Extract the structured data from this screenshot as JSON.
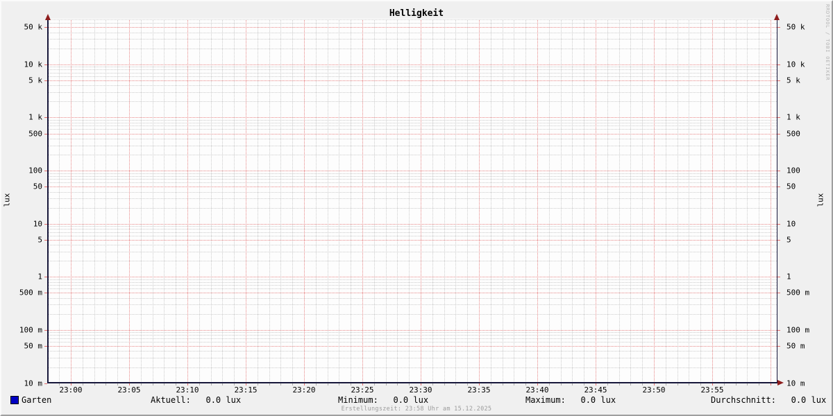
{
  "title": "Helligkeit",
  "watermark": "RRDTOOL / TOBI OETIKER",
  "footer": "Erstellungszeit: 23:58 Uhr am 15.12.2025",
  "axis": {
    "left_label": "lux",
    "right_label": "lux",
    "y_ticks": [
      {
        "label": "50 k",
        "value": 50000
      },
      {
        "label": "10 k",
        "value": 10000
      },
      {
        "label": "5 k",
        "value": 5000
      },
      {
        "label": "1 k",
        "value": 1000
      },
      {
        "label": "500",
        "value": 500
      },
      {
        "label": "100",
        "value": 100
      },
      {
        "label": "50",
        "value": 50
      },
      {
        "label": "10",
        "value": 10
      },
      {
        "label": "5",
        "value": 5
      },
      {
        "label": "1",
        "value": 1
      },
      {
        "label": "500 m",
        "value": 0.5
      },
      {
        "label": "100 m",
        "value": 0.1
      },
      {
        "label": "50 m",
        "value": 0.05
      },
      {
        "label": "10 m",
        "value": 0.01
      }
    ],
    "x_ticks": [
      {
        "label": "23:00",
        "minute": 0
      },
      {
        "label": "23:05",
        "minute": 5
      },
      {
        "label": "23:10",
        "minute": 10
      },
      {
        "label": "23:15",
        "minute": 15
      },
      {
        "label": "23:20",
        "minute": 20
      },
      {
        "label": "23:25",
        "minute": 25
      },
      {
        "label": "23:30",
        "minute": 30
      },
      {
        "label": "23:35",
        "minute": 35
      },
      {
        "label": "23:40",
        "minute": 40
      },
      {
        "label": "23:45",
        "minute": 45
      },
      {
        "label": "23:50",
        "minute": 50
      },
      {
        "label": "23:55",
        "minute": 55
      }
    ]
  },
  "legend": {
    "series_label": "Garten",
    "series_color": "#0000c3",
    "stats": [
      {
        "label": "Aktuell:",
        "value": "0.0 lux"
      },
      {
        "label": "Minimum:",
        "value": "0.0 lux"
      },
      {
        "label": "Maximum:",
        "value": "0.0 lux"
      },
      {
        "label": "Durchschnitt:",
        "value": "0.0 lux"
      }
    ]
  },
  "colors": {
    "background": "#f0f0f0",
    "canvas": "#fdfdfd",
    "grid_major": "#e05c5c",
    "grid_minor": "#919191",
    "axis": "#16163a",
    "arrow": "#8e1d1d",
    "series_blue": "#0000c3",
    "footer_text": "#9c9c9c",
    "watermark_text": "#b4b4b4"
  },
  "chart_data": {
    "type": "line",
    "title": "Helligkeit",
    "xlabel": "",
    "ylabel": "lux",
    "y_scale": "log",
    "ylim": [
      0.01,
      70000
    ],
    "x_ticks": [
      "23:00",
      "23:05",
      "23:10",
      "23:15",
      "23:20",
      "23:25",
      "23:30",
      "23:35",
      "23:40",
      "23:45",
      "23:50",
      "23:55"
    ],
    "grid": "on",
    "legend_position": "bottom",
    "series": [
      {
        "name": "Garten",
        "color": "#0000c3",
        "constant_value": 0.0,
        "unit": "lux",
        "aktuell": 0.0,
        "minimum": 0.0,
        "maximum": 0.0,
        "durchschnitt": 0.0,
        "note": "constant 0.0 lux - no trace visible on logarithmic scale"
      }
    ]
  }
}
